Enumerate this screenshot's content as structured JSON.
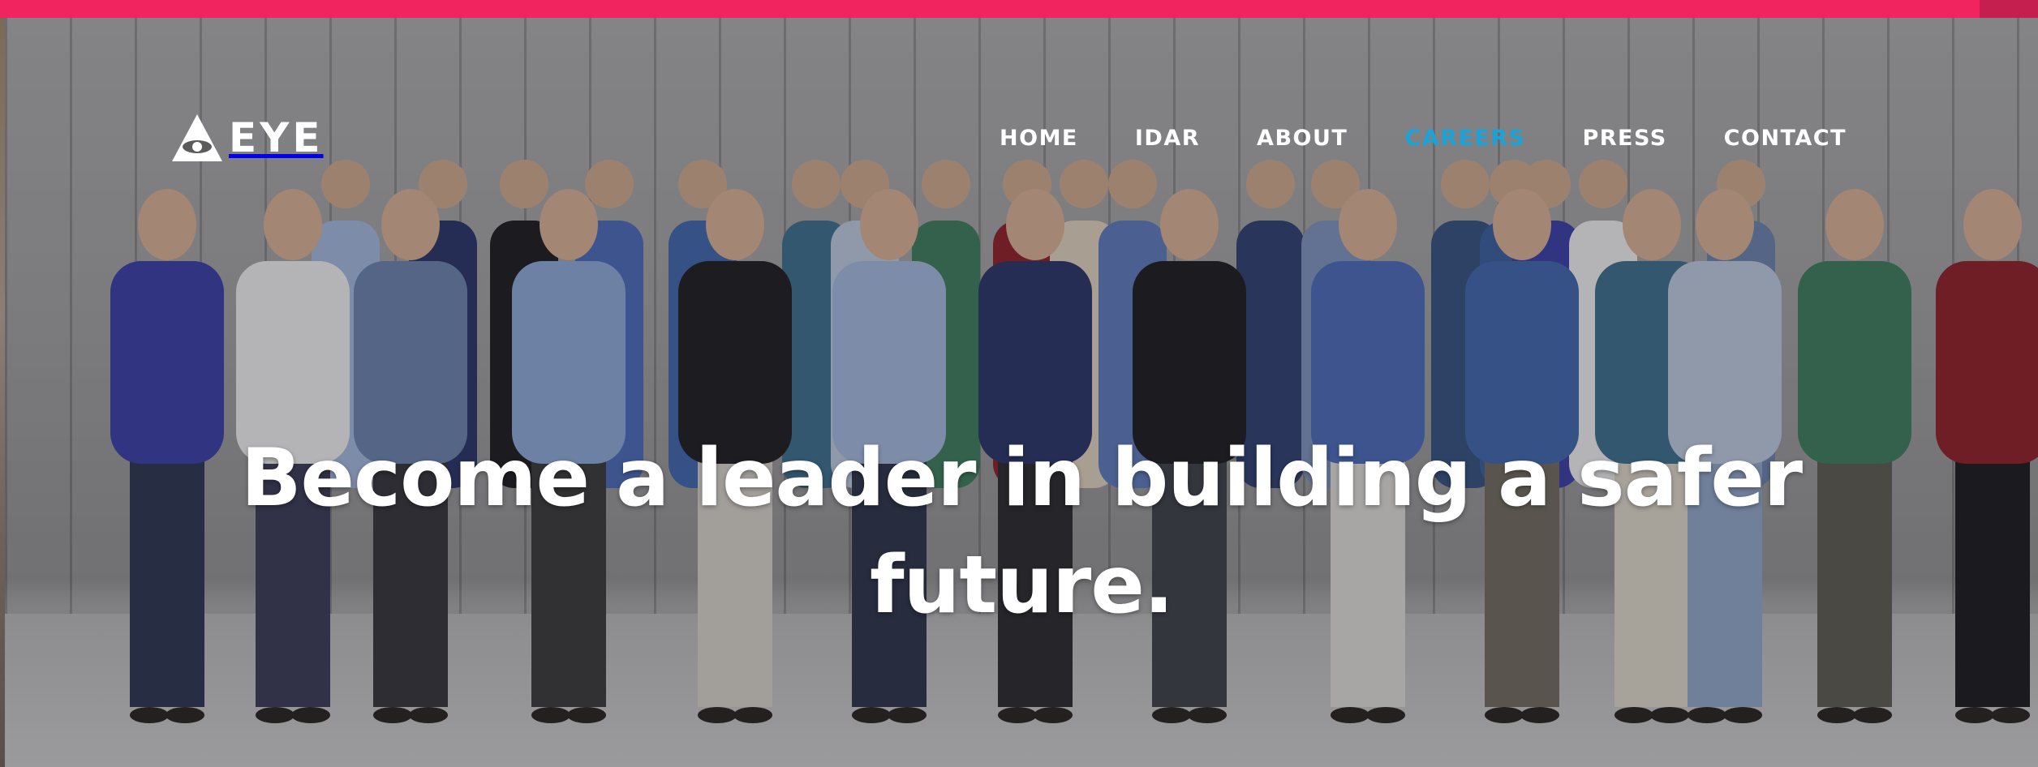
{
  "brand": {
    "logo_text": "EYE",
    "accent_color": "#f22460"
  },
  "nav": {
    "items": [
      {
        "label": "HOME",
        "active": false
      },
      {
        "label": "IDAR",
        "active": false
      },
      {
        "label": "ABOUT",
        "active": false
      },
      {
        "label": "CAREERS",
        "active": true
      },
      {
        "label": "PRESS",
        "active": false
      },
      {
        "label": "CONTACT",
        "active": false
      }
    ],
    "active_color": "#1aa3d9"
  },
  "hero": {
    "headline": "Become a leader in building a safer future."
  }
}
